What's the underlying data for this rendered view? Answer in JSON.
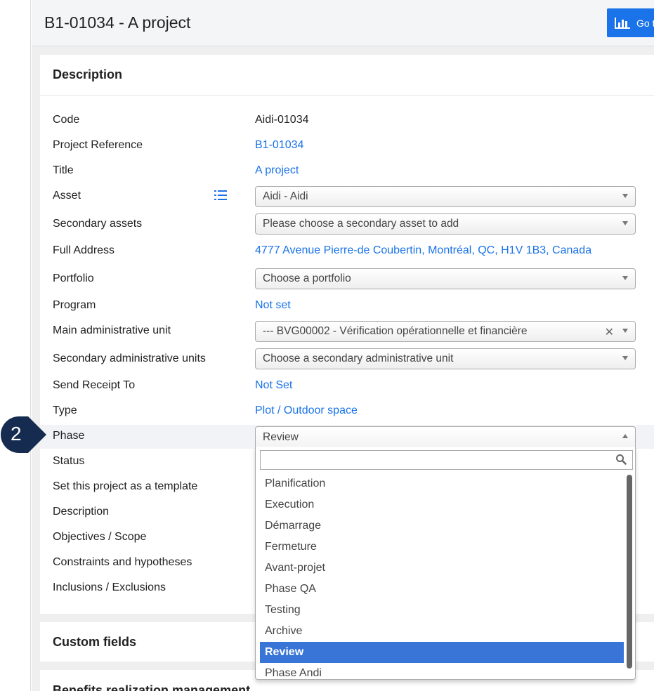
{
  "header": {
    "title": "B1-01034 - A project",
    "go_button_label": "Go t"
  },
  "description_card": {
    "heading": "Description",
    "fields": {
      "code": {
        "label": "Code",
        "value": "Aidi-01034"
      },
      "project_reference": {
        "label": "Project Reference",
        "value": "B1-01034"
      },
      "title": {
        "label": "Title",
        "value": "A project"
      },
      "asset": {
        "label": "Asset",
        "value": "Aidi - Aidi"
      },
      "secondary_assets": {
        "label": "Secondary assets",
        "placeholder": "Please choose a secondary asset to add"
      },
      "full_address": {
        "label": "Full Address",
        "value": "4777 Avenue Pierre-de Coubertin, Montréal, QC, H1V 1B3, Canada"
      },
      "portfolio": {
        "label": "Portfolio",
        "placeholder": "Choose a portfolio"
      },
      "program": {
        "label": "Program",
        "value": "Not set"
      },
      "main_admin_unit": {
        "label": "Main administrative unit",
        "value": "--- BVG00002 - Vérification opérationnelle et financière"
      },
      "secondary_admin_units": {
        "label": "Secondary administrative units",
        "placeholder": "Choose a secondary administrative unit"
      },
      "send_receipt_to": {
        "label": "Send Receipt To",
        "value": "Not Set"
      },
      "type": {
        "label": "Type",
        "value": "Plot / Outdoor space"
      },
      "phase": {
        "label": "Phase",
        "value": "Review"
      },
      "status": {
        "label": "Status"
      },
      "template": {
        "label": "Set this project as a template"
      },
      "description": {
        "label": "Description"
      },
      "objectives": {
        "label": "Objectives / Scope"
      },
      "constraints": {
        "label": "Constraints and hypotheses"
      },
      "inclusions": {
        "label": "Inclusions / Exclusions"
      }
    }
  },
  "phase_dropdown": {
    "search_value": "",
    "options": [
      "Planification",
      "Execution",
      "Démarrage",
      "Fermeture",
      "Avant-projet",
      "Phase QA",
      "Testing",
      "Archive",
      "Review",
      "Phase Andi"
    ],
    "selected": "Review"
  },
  "custom_fields_card": {
    "heading": "Custom fields"
  },
  "benefits_card": {
    "heading": "Benefits realization management"
  },
  "step_badge": {
    "number": "2"
  },
  "colors": {
    "accent": "#1a73e8",
    "selected_option": "#3875d7",
    "badge": "#152b4f"
  }
}
